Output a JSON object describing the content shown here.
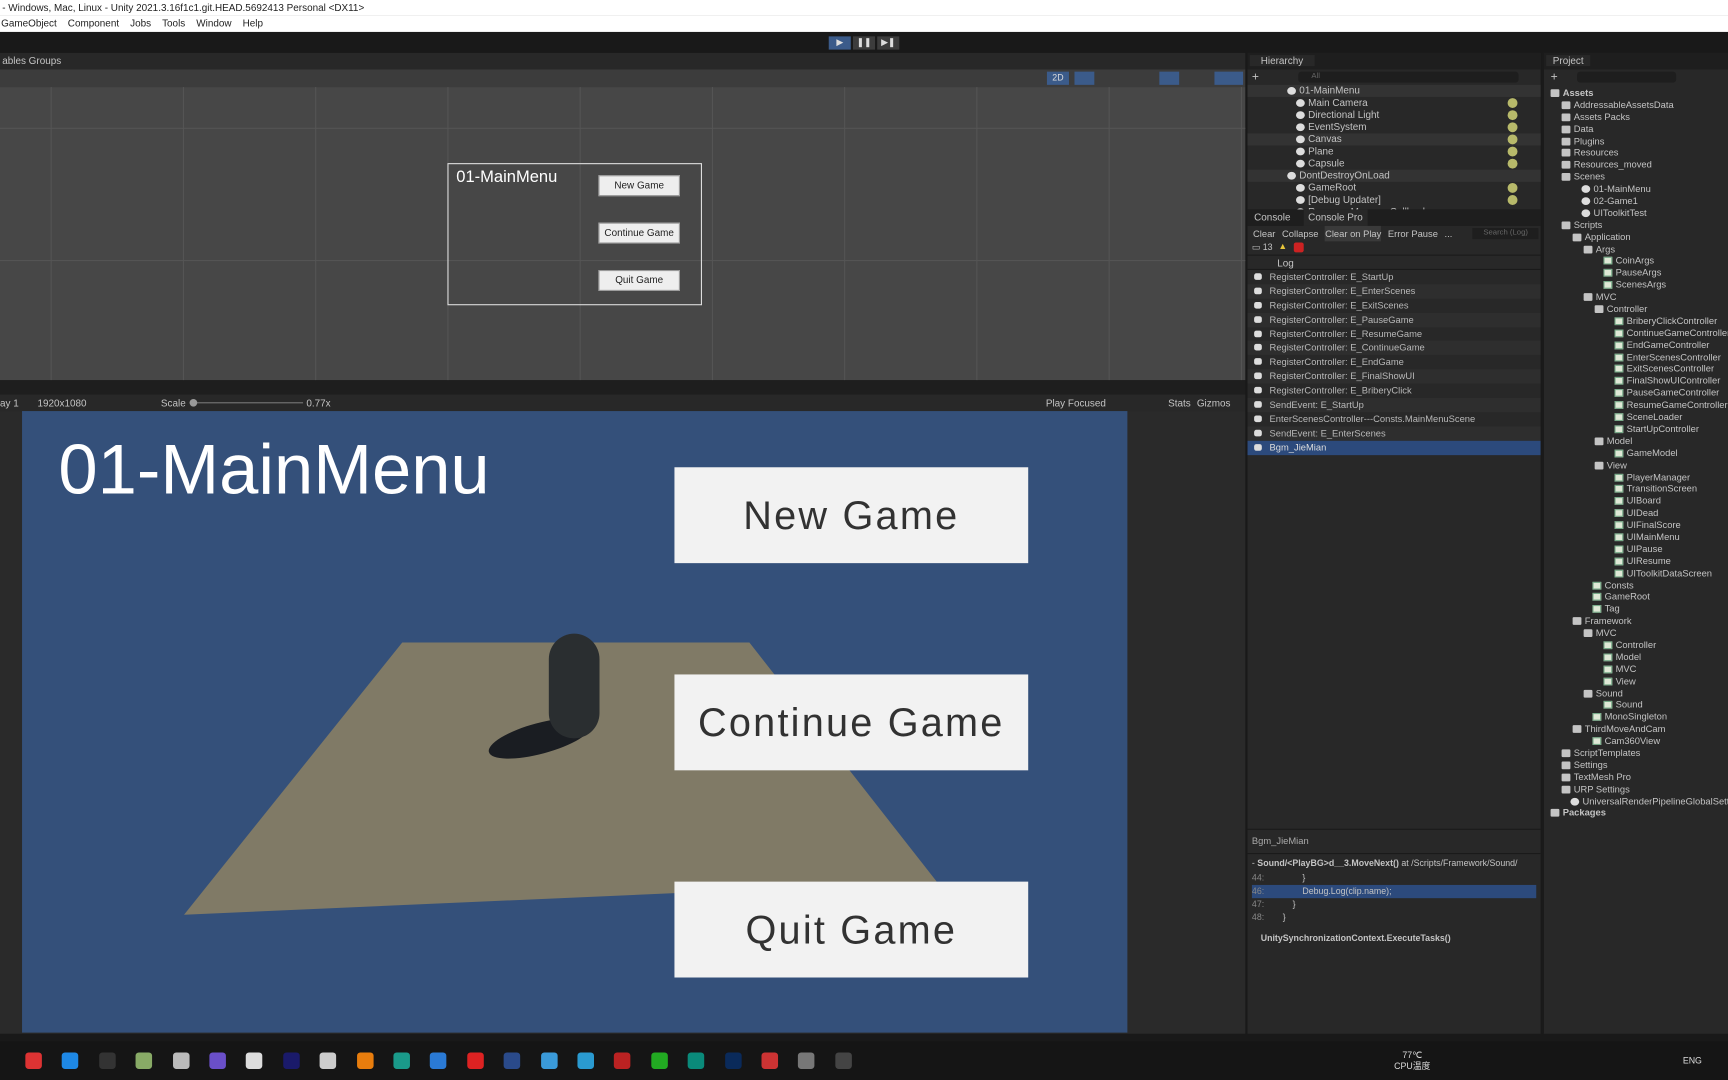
{
  "window": {
    "title": "- Windows, Mac, Linux - Unity 2021.3.16f1c1.git.HEAD.5692413 Personal <DX11>"
  },
  "menu": [
    "GameObject",
    "Component",
    "Jobs",
    "Tools",
    "Window",
    "Help"
  ],
  "toolbar": {
    "play": "▶",
    "pause": "❚❚",
    "step": "▶❚"
  },
  "scene": {
    "tab": "ables Groups",
    "toggle_2d": "2D",
    "canvas_title": "01-MainMenu",
    "buttons": [
      "New Game",
      "Continue Game",
      "Quit Game"
    ]
  },
  "game": {
    "display": "ay 1",
    "resolution": "1920x1080",
    "scale_label": "Scale",
    "scale_value": "0.77x",
    "scale_fraction": 0.0,
    "play_mode": "Play Focused",
    "stats": "Stats",
    "gizmos": "Gizmos",
    "title": "01-MainMenu",
    "buttons": [
      "New Game",
      "Continue Game",
      "Quit Game"
    ],
    "background": "#34507a"
  },
  "hierarchy": {
    "tab": "Hierarchy",
    "search_placeholder": "All",
    "items": [
      {
        "label": "01-MainMenu",
        "scene": true
      },
      {
        "label": "Main Camera"
      },
      {
        "label": "Directional Light"
      },
      {
        "label": "EventSystem"
      },
      {
        "label": "Canvas"
      },
      {
        "label": "Plane"
      },
      {
        "label": "Capsule"
      },
      {
        "label": "DontDestroyOnLoad",
        "scene": true
      },
      {
        "label": "GameRoot"
      },
      {
        "label": "[Debug Updater]"
      },
      {
        "label": "ResourceManagerCallbacks"
      }
    ]
  },
  "console": {
    "tabs": [
      "Console",
      "Console Pro"
    ],
    "buttons": [
      "Clear",
      "Collapse",
      "Clear on Play",
      "Error Pause",
      "..."
    ],
    "search_placeholder": "Search (Log)",
    "log_count": "13",
    "column": "Log",
    "logs": [
      "RegisterController: E_StartUp",
      "RegisterController: E_EnterScenes",
      "RegisterController: E_ExitScenes",
      "RegisterController: E_PauseGame",
      "RegisterController: E_ResumeGame",
      "RegisterController: E_ContinueGame",
      "RegisterController: E_EndGame",
      "RegisterController: E_FinalShowUI",
      "RegisterController: E_BriberyClick",
      "SendEvent: E_StartUp",
      "EnterScenesController---Consts.MainMenuScene",
      "SendEvent: E_EnterScenes",
      "Bgm_JieMian"
    ],
    "selected_index": 12,
    "detail": {
      "message": "Bgm_JieMian",
      "stack_method": "Sound/<PlayBG>d__3.MoveNext()",
      "stack_at": " at /Scripts/Framework/Sound/",
      "code": [
        {
          "n": "44:",
          "t": "        }"
        },
        {
          "n": "46:",
          "t": "        Debug.Log(clip.name);"
        },
        {
          "n": "47:",
          "t": "    }"
        },
        {
          "n": "48:",
          "t": "}"
        }
      ],
      "footer": "UnitySynchronizationContext.ExecuteTasks()"
    }
  },
  "project": {
    "tab": "Project",
    "items": [
      {
        "l": "Assets",
        "d": 0,
        "t": "folder",
        "b": true
      },
      {
        "l": "AddressableAssetsData",
        "d": 1,
        "t": "folder"
      },
      {
        "l": "Assets Packs",
        "d": 1,
        "t": "folder"
      },
      {
        "l": "Data",
        "d": 1,
        "t": "folder"
      },
      {
        "l": "Plugins",
        "d": 1,
        "t": "folder"
      },
      {
        "l": "Resources",
        "d": 1,
        "t": "folder"
      },
      {
        "l": "Resources_moved",
        "d": 1,
        "t": "folder"
      },
      {
        "l": "Scenes",
        "d": 1,
        "t": "folder"
      },
      {
        "l": "01-MainMenu",
        "d": 2,
        "t": "scene"
      },
      {
        "l": "02-Game1",
        "d": 2,
        "t": "scene"
      },
      {
        "l": "UIToolkitTest",
        "d": 2,
        "t": "scene"
      },
      {
        "l": "Scripts",
        "d": 1,
        "t": "folder"
      },
      {
        "l": "Application",
        "d": 2,
        "t": "folder"
      },
      {
        "l": "Args",
        "d": 3,
        "t": "folder"
      },
      {
        "l": "CoinArgs",
        "d": 4,
        "t": "cs"
      },
      {
        "l": "PauseArgs",
        "d": 4,
        "t": "cs"
      },
      {
        "l": "ScenesArgs",
        "d": 4,
        "t": "cs"
      },
      {
        "l": "MVC",
        "d": 3,
        "t": "folder"
      },
      {
        "l": "Controller",
        "d": 4,
        "t": "folder"
      },
      {
        "l": "BriberyClickController",
        "d": 5,
        "t": "cs"
      },
      {
        "l": "ContinueGameController",
        "d": 5,
        "t": "cs"
      },
      {
        "l": "EndGameController",
        "d": 5,
        "t": "cs"
      },
      {
        "l": "EnterScenesController",
        "d": 5,
        "t": "cs"
      },
      {
        "l": "ExitScenesController",
        "d": 5,
        "t": "cs"
      },
      {
        "l": "FinalShowUIController",
        "d": 5,
        "t": "cs"
      },
      {
        "l": "PauseGameController",
        "d": 5,
        "t": "cs"
      },
      {
        "l": "ResumeGameController",
        "d": 5,
        "t": "cs"
      },
      {
        "l": "SceneLoader",
        "d": 5,
        "t": "cs"
      },
      {
        "l": "StartUpController",
        "d": 5,
        "t": "cs"
      },
      {
        "l": "Model",
        "d": 4,
        "t": "folder"
      },
      {
        "l": "GameModel",
        "d": 5,
        "t": "cs"
      },
      {
        "l": "View",
        "d": 4,
        "t": "folder"
      },
      {
        "l": "PlayerManager",
        "d": 5,
        "t": "cs"
      },
      {
        "l": "TransitionScreen",
        "d": 5,
        "t": "cs"
      },
      {
        "l": "UIBoard",
        "d": 5,
        "t": "cs"
      },
      {
        "l": "UIDead",
        "d": 5,
        "t": "cs"
      },
      {
        "l": "UIFinalScore",
        "d": 5,
        "t": "cs"
      },
      {
        "l": "UIMainMenu",
        "d": 5,
        "t": "cs"
      },
      {
        "l": "UIPause",
        "d": 5,
        "t": "cs"
      },
      {
        "l": "UIResume",
        "d": 5,
        "t": "cs"
      },
      {
        "l": "UIToolkitDataScreen",
        "d": 5,
        "t": "cs"
      },
      {
        "l": "Consts",
        "d": 3,
        "t": "cs"
      },
      {
        "l": "GameRoot",
        "d": 3,
        "t": "cs"
      },
      {
        "l": "Tag",
        "d": 3,
        "t": "cs"
      },
      {
        "l": "Framework",
        "d": 2,
        "t": "folder"
      },
      {
        "l": "MVC",
        "d": 3,
        "t": "folder"
      },
      {
        "l": "Controller",
        "d": 4,
        "t": "cs"
      },
      {
        "l": "Model",
        "d": 4,
        "t": "cs"
      },
      {
        "l": "MVC",
        "d": 4,
        "t": "cs"
      },
      {
        "l": "View",
        "d": 4,
        "t": "cs"
      },
      {
        "l": "Sound",
        "d": 3,
        "t": "folder"
      },
      {
        "l": "Sound",
        "d": 4,
        "t": "cs"
      },
      {
        "l": "MonoSingleton",
        "d": 3,
        "t": "cs"
      },
      {
        "l": "ThirdMoveAndCam",
        "d": 2,
        "t": "folder"
      },
      {
        "l": "Cam360View",
        "d": 3,
        "t": "cs"
      },
      {
        "l": "ScriptTemplates",
        "d": 1,
        "t": "folder"
      },
      {
        "l": "Settings",
        "d": 1,
        "t": "folder"
      },
      {
        "l": "TextMesh Pro",
        "d": 1,
        "t": "folder"
      },
      {
        "l": "URP Settings",
        "d": 1,
        "t": "folder"
      },
      {
        "l": "UniversalRenderPipelineGlobalSettings",
        "d": 1,
        "t": "scene"
      },
      {
        "l": "Packages",
        "d": 0,
        "t": "folder",
        "b": true
      }
    ]
  },
  "taskbar": {
    "temp": "77℃",
    "temp_label": "CPU温度",
    "lang": "ENG",
    "icons": [
      "app-red",
      "kugou",
      "qq",
      "paint",
      "unity-hub",
      "github",
      "baidu-netdisk",
      "premiere",
      "monitor",
      "blender",
      "maya",
      "arrow-app",
      "netease-music",
      "cinema4d",
      "file-explorer",
      "edge",
      "davinci",
      "wechat",
      "app-green",
      "photoshop",
      "app-red2",
      "unity",
      "obs"
    ],
    "colors": [
      "#d33",
      "#1e88e5",
      "#333",
      "#8a6",
      "#bbb",
      "#6a4fc9",
      "#ddd",
      "#1a1a6a",
      "#ccc",
      "#e87d0d",
      "#1a9a8a",
      "#2a7ad5",
      "#d22",
      "#2a4a8a",
      "#3a9ad9",
      "#2a9ad0",
      "#b22",
      "#2a2",
      "#0a8a7a",
      "#0a2a5a",
      "#c33",
      "#777",
      "#444"
    ]
  }
}
